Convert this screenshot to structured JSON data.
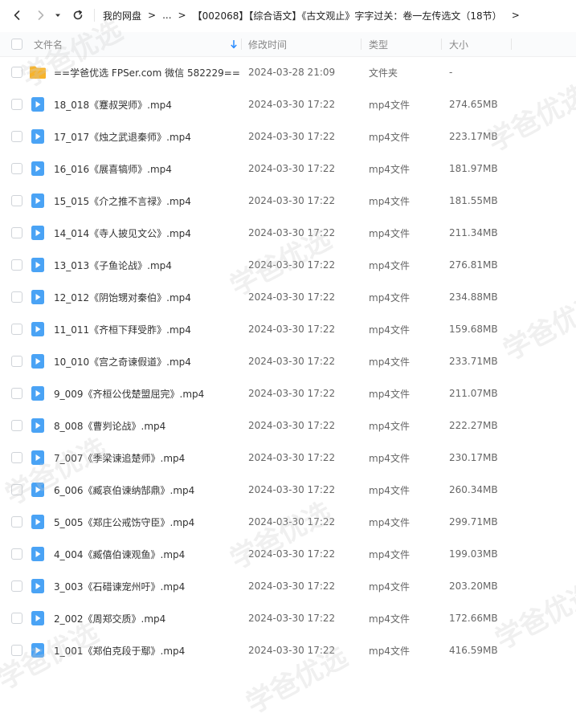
{
  "nav": {
    "back_icon": "chevron-left-icon",
    "forward_icon": "chevron-right-icon",
    "dropdown_icon": "caret-down-icon",
    "refresh_icon": "refresh-icon"
  },
  "breadcrumb": {
    "root": "我的网盘",
    "ellipsis": "...",
    "current": "【002068】【综合语文】《古文观止》字字过关：卷一左传选文（18节）"
  },
  "columns": {
    "name": "文件名",
    "modified": "修改时间",
    "type": "类型",
    "size": "大小"
  },
  "watermark_text": "学爸优选",
  "files": [
    {
      "name": "==学爸优选 FPSer.com 微信 582229==",
      "modified": "2024-03-28 21:09",
      "type": "文件夹",
      "size": "-",
      "icon": "folder-icon"
    },
    {
      "name": "18_018《蹇叔哭师》.mp4",
      "modified": "2024-03-30 17:22",
      "type": "mp4文件",
      "size": "274.65MB",
      "icon": "video-file-icon"
    },
    {
      "name": "17_017《烛之武退秦师》.mp4",
      "modified": "2024-03-30 17:22",
      "type": "mp4文件",
      "size": "223.17MB",
      "icon": "video-file-icon"
    },
    {
      "name": "16_016《展喜犒师》.mp4",
      "modified": "2024-03-30 17:22",
      "type": "mp4文件",
      "size": "181.97MB",
      "icon": "video-file-icon"
    },
    {
      "name": "15_015《介之推不言禄》.mp4",
      "modified": "2024-03-30 17:22",
      "type": "mp4文件",
      "size": "181.55MB",
      "icon": "video-file-icon"
    },
    {
      "name": "14_014《寺人披见文公》.mp4",
      "modified": "2024-03-30 17:22",
      "type": "mp4文件",
      "size": "211.34MB",
      "icon": "video-file-icon"
    },
    {
      "name": "13_013《子鱼论战》.mp4",
      "modified": "2024-03-30 17:22",
      "type": "mp4文件",
      "size": "276.81MB",
      "icon": "video-file-icon"
    },
    {
      "name": "12_012《阴饴甥对秦伯》.mp4",
      "modified": "2024-03-30 17:22",
      "type": "mp4文件",
      "size": "234.88MB",
      "icon": "video-file-icon"
    },
    {
      "name": "11_011《齐桓下拜受胙》.mp4",
      "modified": "2024-03-30 17:22",
      "type": "mp4文件",
      "size": "159.68MB",
      "icon": "video-file-icon"
    },
    {
      "name": "10_010《宫之奇谏假道》.mp4",
      "modified": "2024-03-30 17:22",
      "type": "mp4文件",
      "size": "233.71MB",
      "icon": "video-file-icon"
    },
    {
      "name": "9_009《齐桓公伐楚盟屈完》.mp4",
      "modified": "2024-03-30 17:22",
      "type": "mp4文件",
      "size": "211.07MB",
      "icon": "video-file-icon"
    },
    {
      "name": "8_008《曹刿论战》.mp4",
      "modified": "2024-03-30 17:22",
      "type": "mp4文件",
      "size": "222.27MB",
      "icon": "video-file-icon"
    },
    {
      "name": "7_007《季梁谏追楚师》.mp4",
      "modified": "2024-03-30 17:22",
      "type": "mp4文件",
      "size": "230.17MB",
      "icon": "video-file-icon"
    },
    {
      "name": "6_006《臧哀伯谏纳郜鼎》.mp4",
      "modified": "2024-03-30 17:22",
      "type": "mp4文件",
      "size": "260.34MB",
      "icon": "video-file-icon"
    },
    {
      "name": "5_005《郑庄公戒饬守臣》.mp4",
      "modified": "2024-03-30 17:22",
      "type": "mp4文件",
      "size": "299.71MB",
      "icon": "video-file-icon"
    },
    {
      "name": "4_004《臧僖伯谏观鱼》.mp4",
      "modified": "2024-03-30 17:22",
      "type": "mp4文件",
      "size": "199.03MB",
      "icon": "video-file-icon"
    },
    {
      "name": "3_003《石碏谏宠州吁》.mp4",
      "modified": "2024-03-30 17:22",
      "type": "mp4文件",
      "size": "203.20MB",
      "icon": "video-file-icon"
    },
    {
      "name": "2_002《周郑交质》.mp4",
      "modified": "2024-03-30 17:22",
      "type": "mp4文件",
      "size": "172.66MB",
      "icon": "video-file-icon"
    },
    {
      "name": "1_001《郑伯克段于鄢》.mp4",
      "modified": "2024-03-30 17:22",
      "type": "mp4文件",
      "size": "416.59MB",
      "icon": "video-file-icon"
    }
  ],
  "colors": {
    "accent": "#2b8cff",
    "folder": "#f7b32b",
    "video_icon": "#4aa3f5"
  }
}
